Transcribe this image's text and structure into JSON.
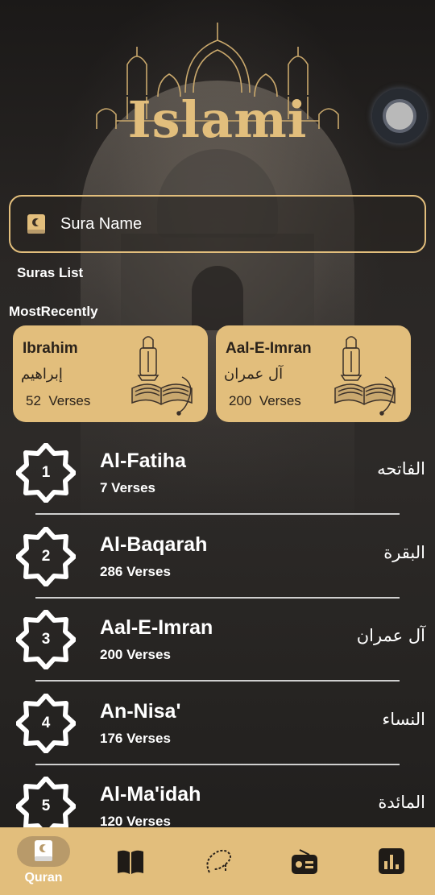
{
  "header": {
    "logo_text": "Islami"
  },
  "search": {
    "placeholder": "Sura Name"
  },
  "sections": {
    "suras_list": "Suras List",
    "most_recently": "MostRecently"
  },
  "recent": [
    {
      "name_en": "Ibrahim",
      "name_ar": "إبراهيم",
      "verses_count": "52",
      "verses_label": "Verses"
    },
    {
      "name_en": "Aal-E-Imran",
      "name_ar": "آل عمران",
      "verses_count": "200",
      "verses_label": "Verses"
    }
  ],
  "suras": [
    {
      "number": "1",
      "name_en": "Al-Fatiha",
      "verses": "7 Verses",
      "name_ar": "الفاتحه"
    },
    {
      "number": "2",
      "name_en": "Al-Baqarah",
      "verses": "286 Verses",
      "name_ar": "البقرة"
    },
    {
      "number": "3",
      "name_en": "Aal-E-Imran",
      "verses": "200 Verses",
      "name_ar": "آل عمران"
    },
    {
      "number": "4",
      "name_en": "An-Nisa'",
      "verses": "176 Verses",
      "name_ar": "النساء"
    },
    {
      "number": "5",
      "name_en": "Al-Ma'idah",
      "verses": "120 Verses",
      "name_ar": "المائدة"
    }
  ],
  "nav": {
    "active_label": "Quran",
    "items": [
      {
        "icon": "quran-icon",
        "label": "Quran"
      },
      {
        "icon": "hadith-book-icon"
      },
      {
        "icon": "sebha-icon"
      },
      {
        "icon": "radio-icon"
      },
      {
        "icon": "time-icon"
      }
    ]
  },
  "colors": {
    "accent": "#e2be7c",
    "background": "#222020",
    "text": "#ffffff",
    "card_text": "#2a221a"
  }
}
